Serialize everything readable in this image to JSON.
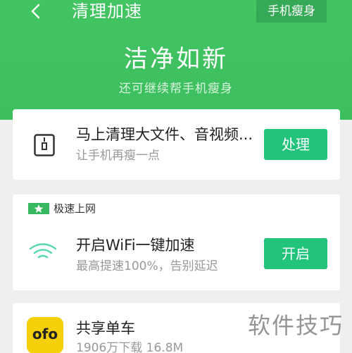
{
  "header": {
    "back_icon": "chevron-left-icon",
    "title": "清理加速",
    "slim_button": "手机瘦身",
    "hero_title": "洁净如新",
    "hero_subtitle": "还可继续帮手机瘦身"
  },
  "cards": {
    "big_files": {
      "icon": "file-icon",
      "title": "马上清理大文件、音视频...",
      "subtitle": "让手机再瘦一点",
      "button": "处理"
    },
    "wifi": {
      "tag": "极速上网",
      "tag_icon": "star-icon",
      "icon": "wifi-icon",
      "title": "开启WiFi一键加速",
      "subtitle": "最高提速100%，告别延迟",
      "button": "开启"
    },
    "ofo": {
      "icon_text": "ofo",
      "title": "共享单车",
      "subtitle": "1906万下载  16.8M"
    }
  },
  "watermark": "软件技巧",
  "colors": {
    "header_green": "#43c463",
    "button_green": "#21c47a",
    "ofo_yellow": "#f5d10b"
  }
}
